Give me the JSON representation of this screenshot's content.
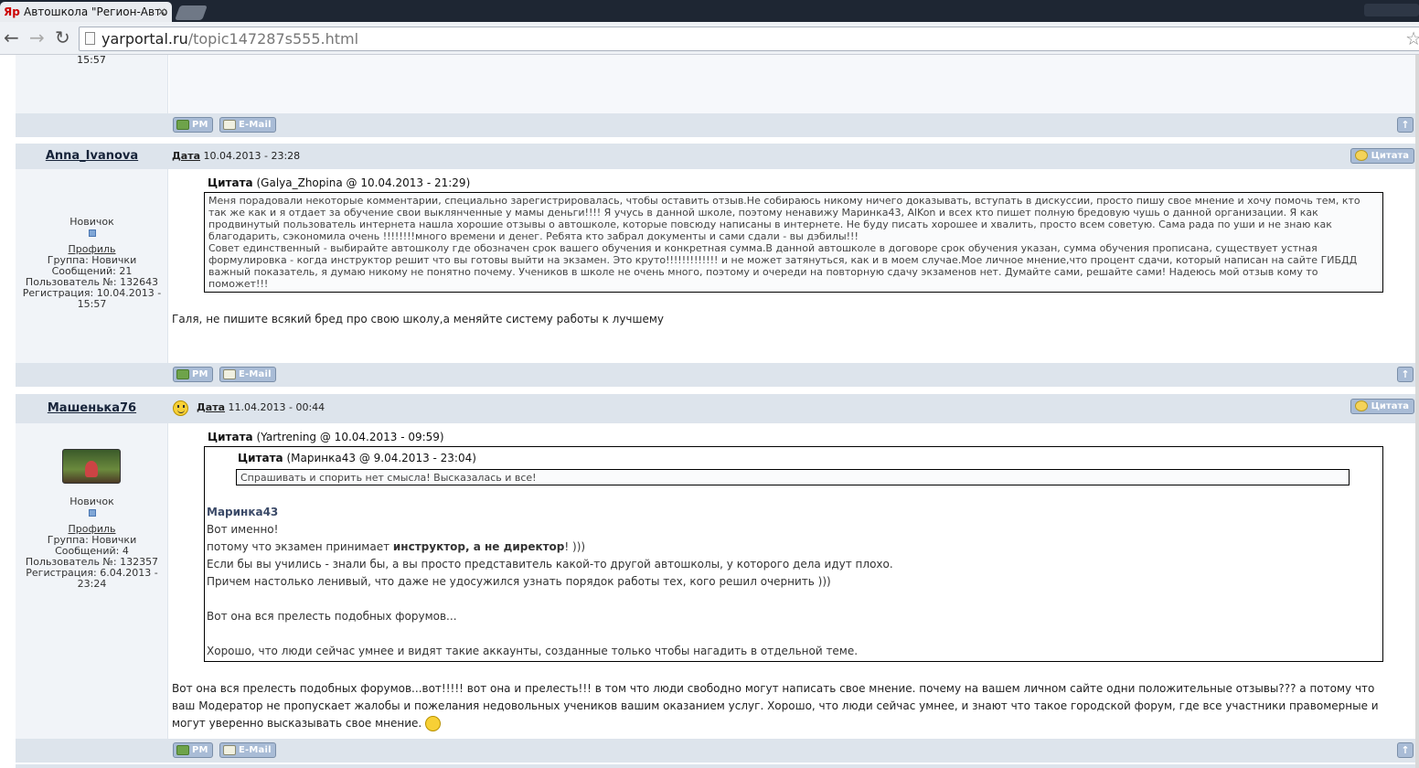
{
  "browser": {
    "tab_title": "Автошкола \"Регион-Авто",
    "tab_favicon": "Яр",
    "url_domain": "yarportal.ru",
    "url_path": "/topic147287s555.html"
  },
  "buttons": {
    "pm": "PM",
    "email": "E-Mail",
    "quote": "Цитата",
    "up": "↑"
  },
  "top_fragment": {
    "time": "15:57"
  },
  "posts": [
    {
      "author": "Anna_Ivanova",
      "date_label": "Дата",
      "date": "10.04.2013 - 23:28",
      "rank": "Новичок",
      "profile_link": "Профиль",
      "group": "Группа: Новички",
      "messages": "Сообщений: 21",
      "user_no": "Пользователь №: 132643",
      "registered": "Регистрация: 10.04.2013 -",
      "registered_time": "15:57",
      "quote_title": "Цитата",
      "quote_source": "(Galya_Zhopina @ 10.04.2013 - 21:29)",
      "quote_lines": [
        "Меня порадовали некоторые комментарии, специально зарегистрировалась, чтобы оставить отзыв.Не собираюсь никому ничего доказывать, вступать в дискуссии, просто пишу свое мнение и хочу помочь тем, кто",
        "так же как и я отдает за обучение свои выклянченные у мамы деньги!!!! Я учусь в данной школе, поэтому ненавижу Маринка43, AlKon и всех кто пишет полную бредовую чушь о данной организации. Я как",
        "продвинутый пользователь интернета нашла хорошие отзывы о автошколе, которые повсюду написаны в интернете. Не буду писать хорошее и хвалить, просто всем советую. Сама рада по уши и не знаю как",
        "благодарить, сэкономила очень !!!!!!!!много времени и денег. Ребята кто забрал документы и сами сдали - вы дэбилы!!!",
        "Совет единственный - выбирайте автошколу где обозначен срок вашего обучения и конкретная сумма.В данной автошколе в договоре срок обучения указан, сумма обучения прописана, существует устная",
        "формулировка - когда инструктор решит что вы готовы выйти на экзамен. Это круто!!!!!!!!!!!!! и не может затянуться, как и в моем случае.Мое личное мнение,что процент сдачи, который написан на сайте ГИБДД",
        "важный показатель, я думаю никому не понятно почему. Учеников в школе не очень много, поэтому и очереди на повторную сдачу экзаменов нет. Думайте сами, решайте сами! Надеюсь мой отзыв кому то",
        "поможет!!!"
      ],
      "body": "Галя, не пишите всякий бред про свою школу,а меняйте систему работы к лучшему"
    },
    {
      "author": "Машенька76",
      "date_label": "Дата",
      "date": "11.04.2013 - 00:44",
      "rank": "Новичок",
      "profile_link": "Профиль",
      "group": "Группа: Новички",
      "messages": "Сообщений: 4",
      "user_no": "Пользователь №: 132357",
      "registered": "Регистрация: 6.04.2013 -",
      "registered_time": "23:24",
      "quote_title": "Цитата",
      "quote_source": "(Yartrening @ 10.04.2013 - 09:59)",
      "nested_quote_title": "Цитата",
      "nested_quote_source": "(Маринка43 @ 9.04.2013 - 23:04)",
      "nested_quote_text": "Спрашивать и спорить  нет смысла! Высказалась и все!",
      "quote_author": "Маринка43",
      "quote_l1": "Вот именно!",
      "quote_l2_pre": "потому что экзамен принимает ",
      "quote_l2_bold": "инструктор, а не директор",
      "quote_l2_post": "! )))",
      "quote_l3": "Если бы вы учились - знали бы, а вы просто представитель какой-то другой автошколы, у которого дела идут плохо.",
      "quote_l4": "Причем настолько ленивый, что даже не удосужился узнать порядок работы тех, кого решил очернить )))",
      "quote_l5": "Вот она вся прелесть подобных форумов...",
      "quote_l6": "Хорошо, что люди сейчас умнее и видят такие аккаунты, созданные только чтобы нагадить в отдельной теме.",
      "body_l1": "Вот она вся прелесть подобных форумов...вот!!!!! вот она и прелесть!!! в том что люди свободно могут написать свое мнение. почему на вашем личном сайте одни положительные отзывы??? а потому что",
      "body_l2": "ваш Модератор не пропускает жалобы и пожелания недовольных учеников вашим оказанием услуг. Хорошо, что люди сейчас умнее, и знают что такое городской форум, где все участники правомерные и",
      "body_l3": "могут уверенно высказывать свое мнение."
    }
  ]
}
